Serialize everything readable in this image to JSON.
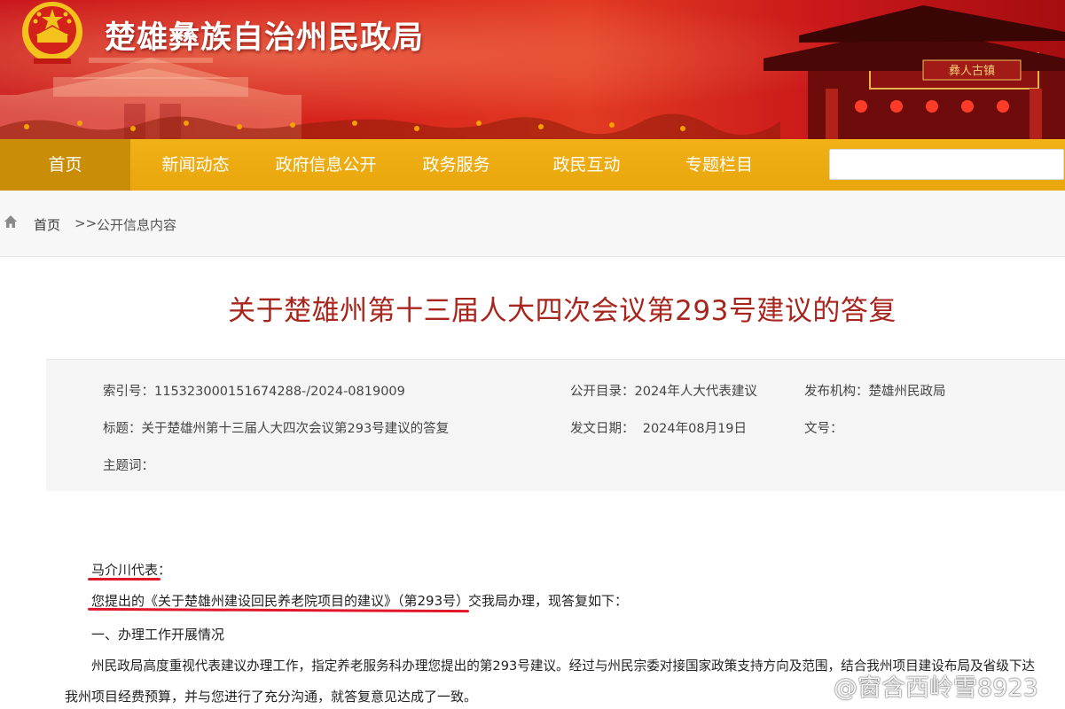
{
  "header": {
    "site_title": "楚雄彝族自治州民政局",
    "colors": {
      "banner_red": "#d9261c",
      "nav_gold": "#f1b117",
      "title_red": "#a8251d",
      "markup_red": "#e0162b"
    }
  },
  "nav": {
    "items": [
      {
        "label": "首页",
        "active": true
      },
      {
        "label": "新闻动态"
      },
      {
        "label": "政府信息公开"
      },
      {
        "label": "政务服务"
      },
      {
        "label": "政民互动"
      },
      {
        "label": "专题栏目"
      }
    ],
    "search_value": ""
  },
  "breadcrumb": {
    "icon": "home-icon",
    "home": "首页",
    "separator": ">>",
    "current": "公开信息内容"
  },
  "article": {
    "title": "关于楚雄州第十三届人大四次会议第293号建议的答复",
    "meta": {
      "index_no": "索引号：115323000151674288-/2024-0819009",
      "catalog": "公开目录：2024年人大代表建议",
      "publisher": "发布机构：楚雄州民政局",
      "subject": "标题：关于楚雄州第十三届人大四次会议第293号建议的答复",
      "date": "发文日期：  2024年08月19日",
      "doc_no": "文号：",
      "keywords": "主题词："
    },
    "body": {
      "salutation": "马介川代表：",
      "intro_highlight": "您提出的《关于楚雄州建设回民养老院项目的建议》（第293号）",
      "intro_rest": "交我局办理，现答复如下：",
      "section1": "一、办理工作开展情况",
      "para1_line1": "州民政局高度重视代表建议办理工作，指定养老服务科办理您提出的第293号建议。经过与州民宗委对接国家政策支持方向及范围，结合我州项目建设布局及省级下达",
      "para1_line2": "我州项目经费预算，并与您进行了充分沟通，就答复意见达成了一致。"
    }
  },
  "watermark": {
    "icon": "weibo-icon",
    "text": "@窗含西岭雪8923"
  }
}
